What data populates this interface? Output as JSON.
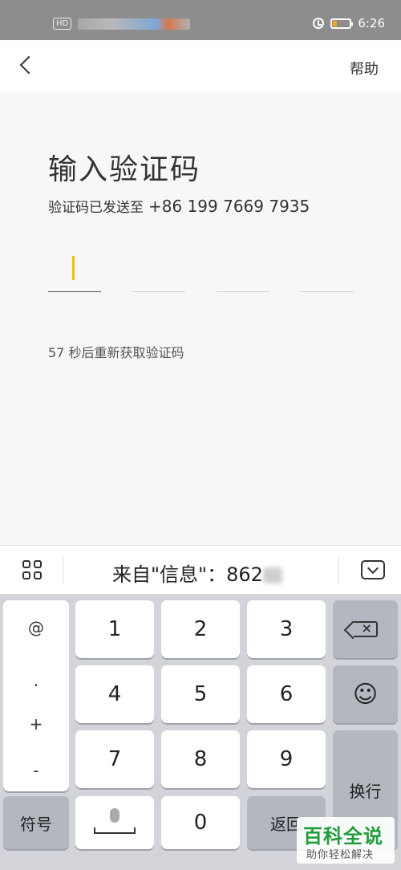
{
  "status_bar": {
    "badge": "HD",
    "time": "6:26",
    "accent": "#f5a623"
  },
  "nav": {
    "help_label": "帮助",
    "back_icon": "chevron-left-icon"
  },
  "main": {
    "title": "输入验证码",
    "sent_prefix": "验证码已发送至",
    "phone": "+86 199 7669 7935",
    "resend_text": "57 秒后重新获取验证码",
    "cursor_color": "#f2c200"
  },
  "keyboard": {
    "suggestion": "来自\"信息\"：862",
    "symbols": [
      "@",
      ".",
      "+",
      "-"
    ],
    "keys": [
      "1",
      "2",
      "3",
      "4",
      "5",
      "6",
      "7",
      "8",
      "9",
      "0"
    ],
    "symbol_key": "符号",
    "return_key": "返回",
    "newline_key": "换行"
  },
  "watermark": {
    "title": "百科全说",
    "subtitle": "助你轻松解决"
  }
}
